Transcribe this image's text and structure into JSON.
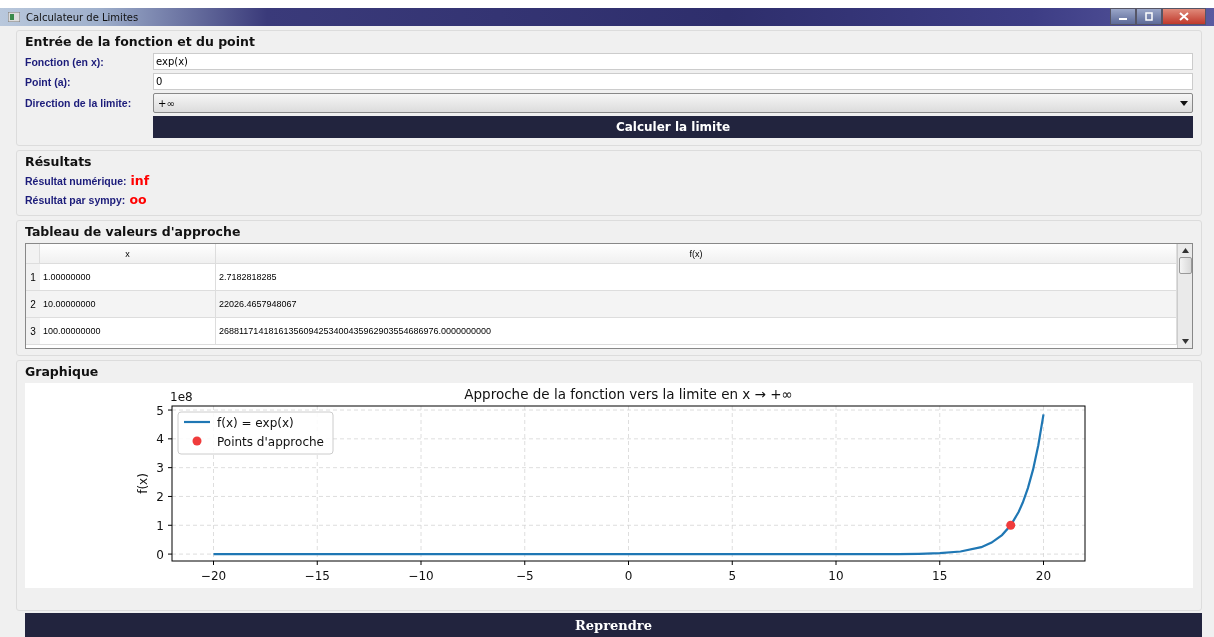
{
  "window": {
    "title": "Calculateur de Limites"
  },
  "input_group": {
    "title": "Entrée de la fonction et du point",
    "fields": [
      {
        "kind": "text",
        "label": "Fonction (en x):",
        "value": "exp(x)"
      },
      {
        "kind": "text",
        "label": "Point (a):",
        "value": "0"
      },
      {
        "kind": "dropdown",
        "label": "Direction de la limite:",
        "value": "+∞"
      }
    ],
    "button": "Calculer la limite"
  },
  "results": {
    "title": "Résultats",
    "items": [
      {
        "label": "Résultat numérique:",
        "value": "inf"
      },
      {
        "label": "Résultat par sympy:",
        "value": "oo"
      }
    ]
  },
  "table": {
    "title": "Tableau de valeurs d'approche",
    "columns": [
      "x",
      "f(x)"
    ],
    "rows": [
      {
        "index": "1",
        "cells": [
          "1.00000000",
          "2.7182818285"
        ]
      },
      {
        "index": "2",
        "cells": [
          "10.00000000",
          "22026.4657948067"
        ]
      },
      {
        "index": "3",
        "cells": [
          "100.00000000",
          "26881171418161356094253400435962903554686976.0000000000"
        ]
      }
    ]
  },
  "graph": {
    "title": "Graphique",
    "offset_label": "1e8",
    "chart_data": {
      "type": "line",
      "title": "Approche de la fonction vers la limite en x → +∞",
      "ylabel": "f(x)",
      "x": [
        -20,
        -15,
        -10,
        -5,
        0,
        5,
        10,
        12,
        13,
        14,
        15,
        16,
        17,
        17.5,
        18,
        18.42,
        18.8,
        19,
        19.25,
        19.5,
        19.75,
        20
      ],
      "series": [
        {
          "name": "f(x) = exp(x)",
          "color": "#1f77b4",
          "values": [
            0,
            0,
            0,
            0,
            0,
            0,
            0,
            0,
            0,
            0.01,
            0.03,
            0.09,
            0.24,
            0.4,
            0.66,
            1.0,
            1.46,
            1.79,
            2.29,
            2.94,
            3.78,
            4.85
          ]
        },
        {
          "name": "Points d'approche",
          "marker": "o",
          "color": "#f03c3c",
          "values": [
            null,
            null,
            null,
            null,
            null,
            null,
            null,
            null,
            null,
            null,
            null,
            null,
            null,
            null,
            null,
            1.0,
            null,
            null,
            null,
            null,
            null,
            null
          ]
        }
      ],
      "grid": true,
      "legend": true,
      "xlim": [
        -22,
        22
      ],
      "ylim": [
        -0.24,
        5.14
      ],
      "xticks": [
        {
          "value": -20,
          "label": "−20"
        },
        {
          "value": -15,
          "label": "−15"
        },
        {
          "value": -10,
          "label": "−10"
        },
        {
          "value": -5,
          "label": "−5"
        },
        {
          "value": 0,
          "label": "0"
        },
        {
          "value": 5,
          "label": "5"
        },
        {
          "value": 10,
          "label": "10"
        },
        {
          "value": 15,
          "label": "15"
        },
        {
          "value": 20,
          "label": "20"
        }
      ],
      "yticks": [
        {
          "value": 0,
          "label": "0"
        },
        {
          "value": 1,
          "label": "1"
        },
        {
          "value": 2,
          "label": "2"
        },
        {
          "value": 3,
          "label": "3"
        },
        {
          "value": 4,
          "label": "4"
        },
        {
          "value": 5,
          "label": "5"
        }
      ]
    }
  },
  "footer_button": "Reprendre"
}
